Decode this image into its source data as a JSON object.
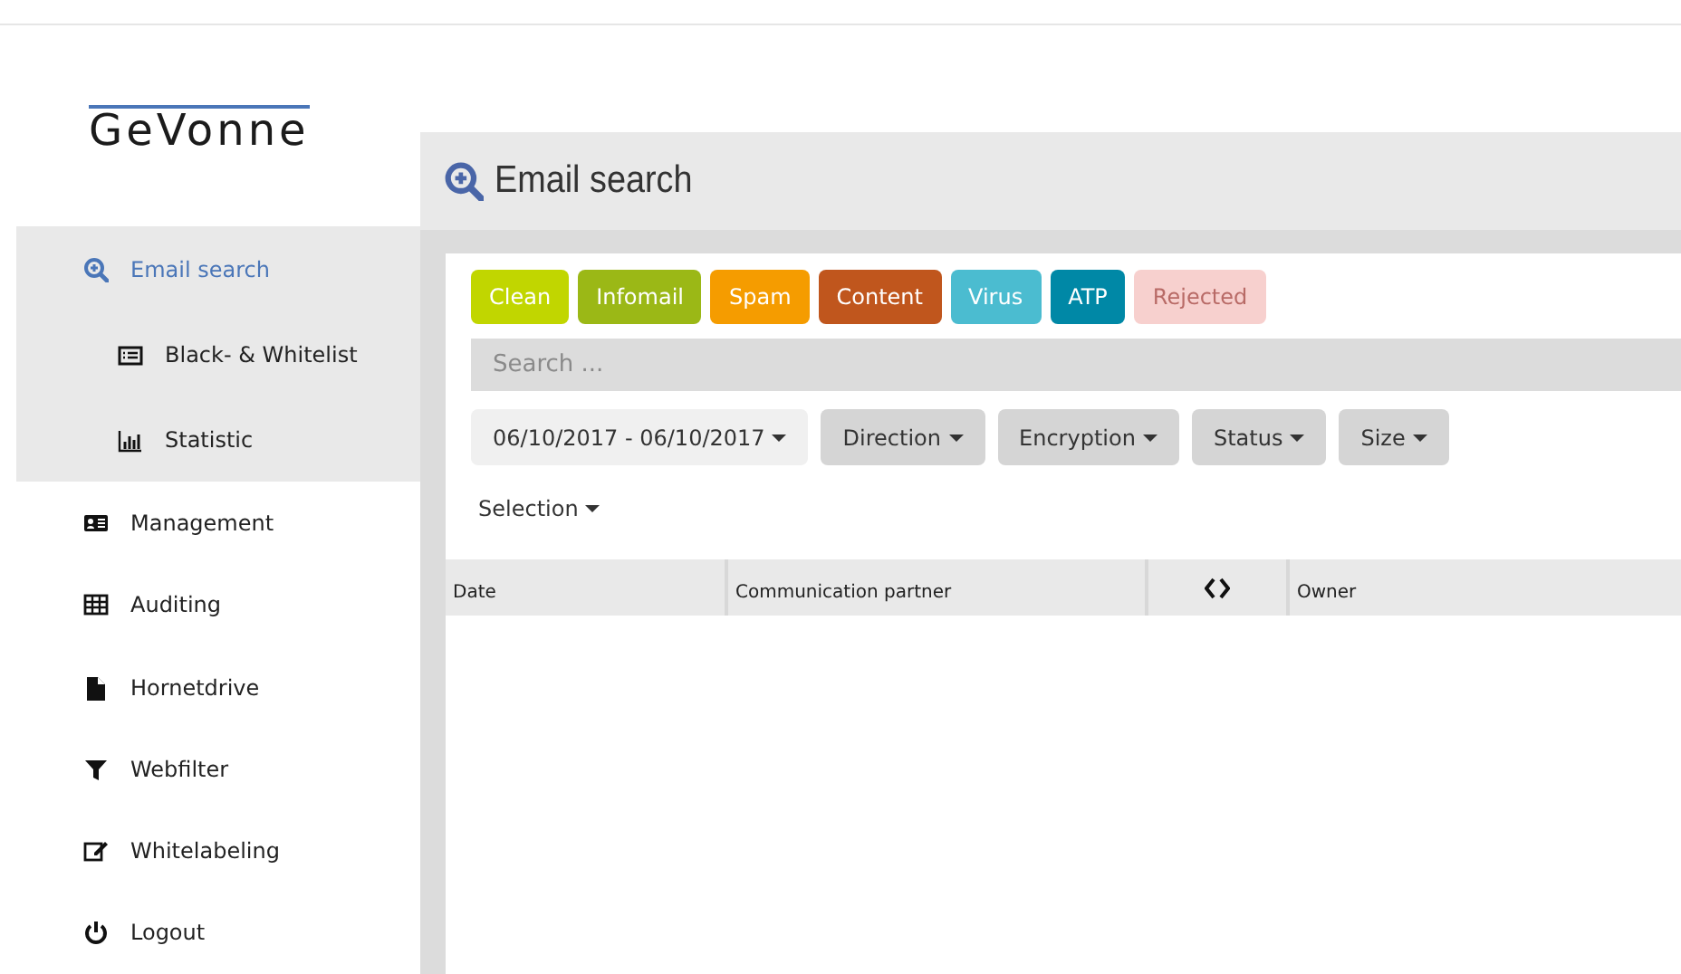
{
  "logo": {
    "text": "GeVonne"
  },
  "sidebar": {
    "items": [
      {
        "label": "Email search",
        "kind": "search",
        "selected": true,
        "children": [
          {
            "label": "Black- & Whitelist",
            "kind": "list",
            "selected": false
          },
          {
            "label": "Statistic",
            "kind": "chart",
            "selected": false
          }
        ]
      },
      {
        "label": "Management",
        "kind": "card",
        "selected": false
      },
      {
        "label": "Auditing",
        "kind": "table",
        "selected": false
      },
      {
        "label": "Hornetdrive",
        "kind": "file",
        "selected": false
      },
      {
        "label": "Webfilter",
        "kind": "filter",
        "selected": false
      },
      {
        "label": "Whitelabeling",
        "kind": "edit",
        "selected": false
      },
      {
        "label": "Logout",
        "kind": "power",
        "selected": false
      }
    ]
  },
  "page": {
    "title": "Email search"
  },
  "tags": [
    {
      "label": "Clean",
      "color": "#c1d600",
      "active": true
    },
    {
      "label": "Infomail",
      "color": "#9bb816",
      "active": true
    },
    {
      "label": "Spam",
      "color": "#f59c00",
      "active": true
    },
    {
      "label": "Content",
      "color": "#c0561d",
      "active": true
    },
    {
      "label": "Virus",
      "color": "#4bbcd0",
      "active": true
    },
    {
      "label": "ATP",
      "color": "#0088a6",
      "active": true
    },
    {
      "label": "Rejected",
      "color": "#f7d0ce",
      "active": false
    }
  ],
  "search": {
    "placeholder": "Search ..."
  },
  "filters": [
    {
      "label": "06/10/2017 - 06/10/2017",
      "kind": "light"
    },
    {
      "label": "Direction",
      "kind": "dark"
    },
    {
      "label": "Encryption",
      "kind": "dark"
    },
    {
      "label": "Status",
      "kind": "dark"
    },
    {
      "label": "Size",
      "kind": "dark"
    },
    {
      "label": "Selection",
      "kind": "plain"
    }
  ],
  "table": {
    "columns": [
      {
        "kind": "text",
        "label": "Date"
      },
      {
        "kind": "text",
        "label": "Communication partner"
      },
      {
        "kind": "icon"
      },
      {
        "kind": "text",
        "label": "Owner"
      }
    ]
  }
}
